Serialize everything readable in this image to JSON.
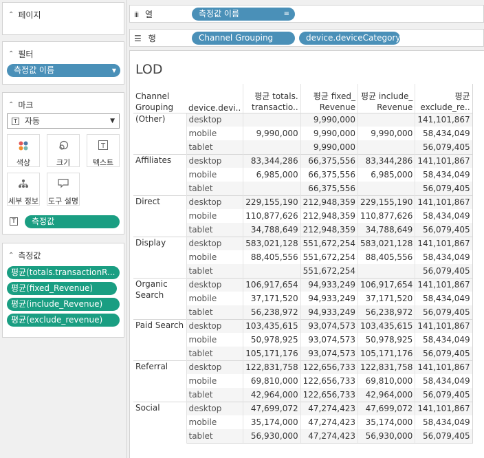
{
  "pages_card": {
    "title": "페이지"
  },
  "filters_card": {
    "title": "필터",
    "pill": "측정값 이름"
  },
  "marks_card": {
    "title": "마크",
    "mark_type": "자동",
    "buttons": [
      "색상",
      "크기",
      "텍스트",
      "세부 정보",
      "도구 설명"
    ],
    "text_pill": "측정값"
  },
  "measures_card": {
    "title": "측정값",
    "items": [
      "평균(totals.transactionR...",
      "평균(fixed_Revenue)",
      "평균(include_Revenue)",
      "평균(exclude_revenue)"
    ]
  },
  "columns_shelf": {
    "title": "열",
    "pill": "측정값 이름"
  },
  "rows_shelf": {
    "title": "행",
    "pills": [
      "Channel Grouping",
      "device.deviceCategory"
    ]
  },
  "view": {
    "title": "LOD",
    "headers": {
      "channel_grouping": [
        "Channel",
        "Grouping"
      ],
      "device": "device.devi..",
      "measures": [
        [
          "평균 totals.",
          "transactio.."
        ],
        [
          "평균 fixed_",
          "Revenue"
        ],
        [
          "평균 include_",
          "Revenue"
        ],
        [
          "평균",
          "exclude_re.."
        ]
      ]
    },
    "groups": [
      {
        "name": [
          "(Other)"
        ],
        "rows": [
          {
            "device": "desktop",
            "values": [
              "",
              "9,990,000",
              "",
              "141,101,867"
            ]
          },
          {
            "device": "mobile",
            "values": [
              "9,990,000",
              "9,990,000",
              "9,990,000",
              "58,434,049"
            ]
          },
          {
            "device": "tablet",
            "values": [
              "",
              "9,990,000",
              "",
              "56,079,405"
            ]
          }
        ]
      },
      {
        "name": [
          "Affiliates"
        ],
        "rows": [
          {
            "device": "desktop",
            "values": [
              "83,344,286",
              "66,375,556",
              "83,344,286",
              "141,101,867"
            ]
          },
          {
            "device": "mobile",
            "values": [
              "6,985,000",
              "66,375,556",
              "6,985,000",
              "58,434,049"
            ]
          },
          {
            "device": "tablet",
            "values": [
              "",
              "66,375,556",
              "",
              "56,079,405"
            ]
          }
        ]
      },
      {
        "name": [
          "Direct"
        ],
        "rows": [
          {
            "device": "desktop",
            "values": [
              "229,155,190",
              "212,948,359",
              "229,155,190",
              "141,101,867"
            ]
          },
          {
            "device": "mobile",
            "values": [
              "110,877,626",
              "212,948,359",
              "110,877,626",
              "58,434,049"
            ]
          },
          {
            "device": "tablet",
            "values": [
              "34,788,649",
              "212,948,359",
              "34,788,649",
              "56,079,405"
            ]
          }
        ]
      },
      {
        "name": [
          "Display"
        ],
        "rows": [
          {
            "device": "desktop",
            "values": [
              "583,021,128",
              "551,672,254",
              "583,021,128",
              "141,101,867"
            ]
          },
          {
            "device": "mobile",
            "values": [
              "88,405,556",
              "551,672,254",
              "88,405,556",
              "58,434,049"
            ]
          },
          {
            "device": "tablet",
            "values": [
              "",
              "551,672,254",
              "",
              "56,079,405"
            ]
          }
        ]
      },
      {
        "name": [
          "Organic",
          "Search"
        ],
        "rows": [
          {
            "device": "desktop",
            "values": [
              "106,917,654",
              "94,933,249",
              "106,917,654",
              "141,101,867"
            ]
          },
          {
            "device": "mobile",
            "values": [
              "37,171,520",
              "94,933,249",
              "37,171,520",
              "58,434,049"
            ]
          },
          {
            "device": "tablet",
            "values": [
              "56,238,972",
              "94,933,249",
              "56,238,972",
              "56,079,405"
            ]
          }
        ]
      },
      {
        "name": [
          "Paid Search"
        ],
        "rows": [
          {
            "device": "desktop",
            "values": [
              "103,435,615",
              "93,074,573",
              "103,435,615",
              "141,101,867"
            ]
          },
          {
            "device": "mobile",
            "values": [
              "50,978,925",
              "93,074,573",
              "50,978,925",
              "58,434,049"
            ]
          },
          {
            "device": "tablet",
            "values": [
              "105,171,176",
              "93,074,573",
              "105,171,176",
              "56,079,405"
            ]
          }
        ]
      },
      {
        "name": [
          "Referral"
        ],
        "rows": [
          {
            "device": "desktop",
            "values": [
              "122,831,758",
              "122,656,733",
              "122,831,758",
              "141,101,867"
            ]
          },
          {
            "device": "mobile",
            "values": [
              "69,810,000",
              "122,656,733",
              "69,810,000",
              "58,434,049"
            ]
          },
          {
            "device": "tablet",
            "values": [
              "42,964,000",
              "122,656,733",
              "42,964,000",
              "56,079,405"
            ]
          }
        ]
      },
      {
        "name": [
          "Social"
        ],
        "rows": [
          {
            "device": "desktop",
            "values": [
              "47,699,072",
              "47,274,423",
              "47,699,072",
              "141,101,867"
            ]
          },
          {
            "device": "mobile",
            "values": [
              "35,174,000",
              "47,274,423",
              "35,174,000",
              "58,434,049"
            ]
          },
          {
            "device": "tablet",
            "values": [
              "56,930,000",
              "47,274,423",
              "56,930,000",
              "56,079,405"
            ]
          }
        ]
      }
    ]
  },
  "colors": {
    "measure_pill": "#1a9e82",
    "dimension_pill": "#4a90b8",
    "panel_bg": "#f0f0f0"
  }
}
